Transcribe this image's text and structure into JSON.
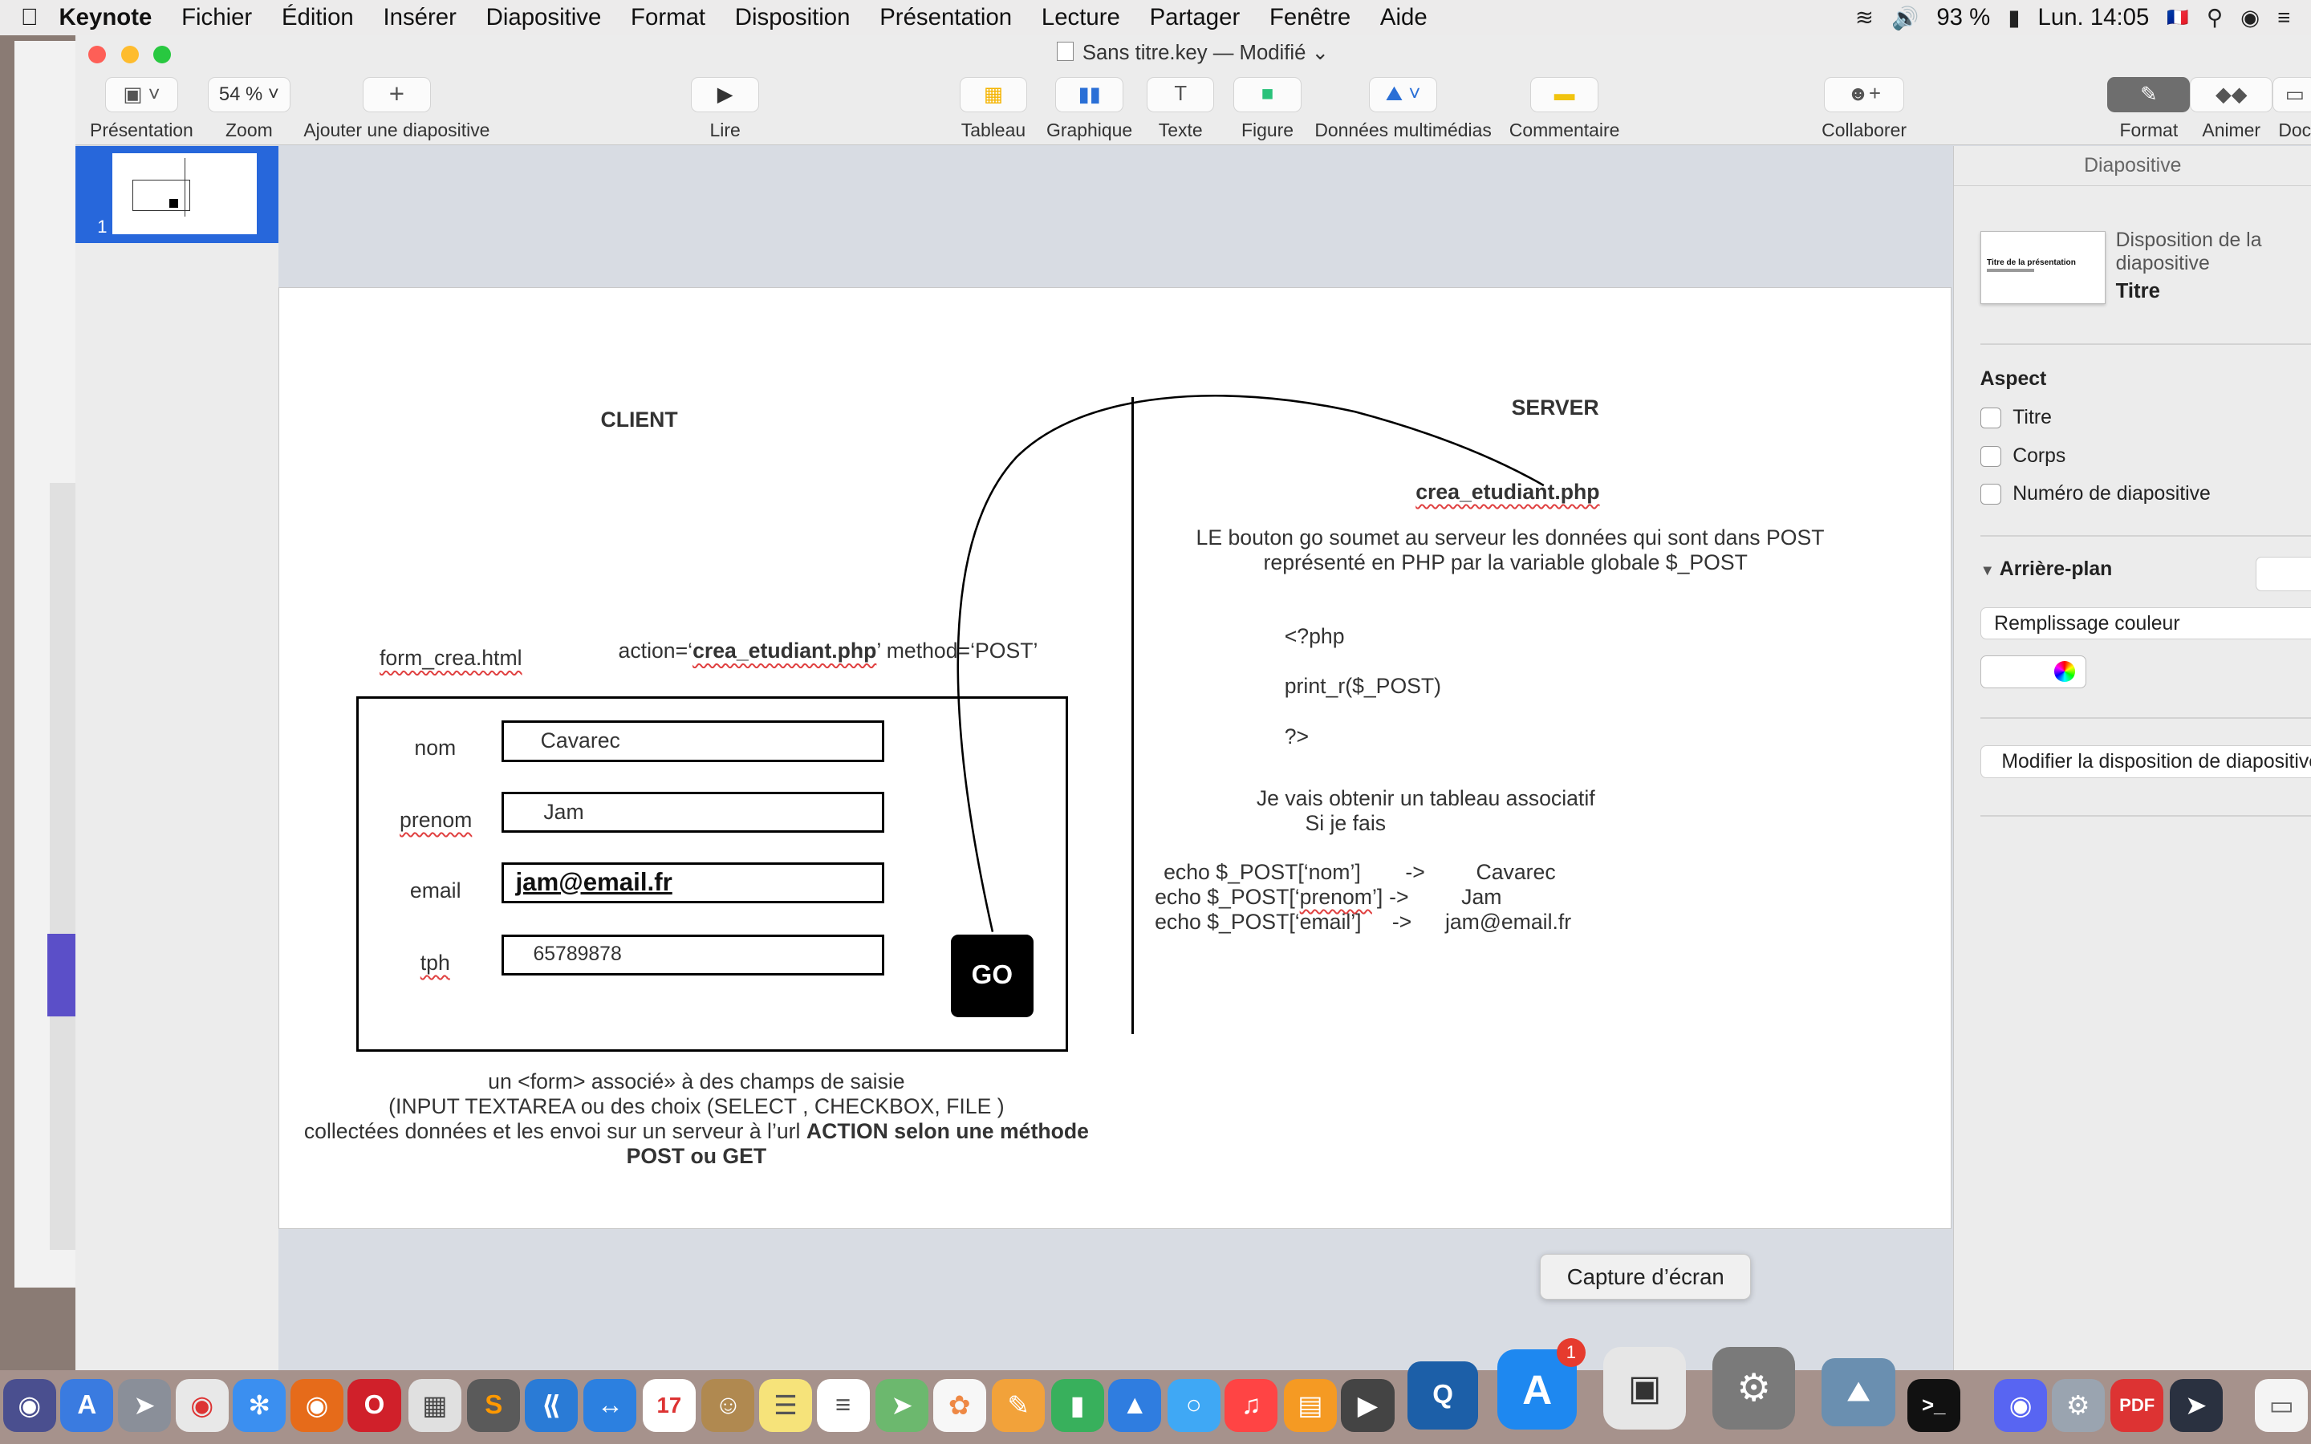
{
  "menubar": {
    "app_name": "Keynote",
    "items": [
      "Fichier",
      "Édition",
      "Insérer",
      "Diapositive",
      "Format",
      "Disposition",
      "Présentation",
      "Lecture",
      "Partager",
      "Fenêtre",
      "Aide"
    ],
    "battery": "93 %",
    "clock": "Lun. 14:05"
  },
  "window": {
    "title": "Sans titre.key — Modifié ⌄"
  },
  "toolbar": {
    "presentation": "Présentation",
    "zoom_value": "54 %",
    "zoom": "Zoom",
    "add_slide": "Ajouter une diapositive",
    "play": "Lire",
    "table": "Tableau",
    "chart": "Graphique",
    "text": "Texte",
    "shape": "Figure",
    "media": "Données multimédias",
    "comment": "Commentaire",
    "collaborate": "Collaborer",
    "format": "Format",
    "animate": "Animer",
    "document": "Doc"
  },
  "navigator": {
    "slide_number": "1"
  },
  "slide": {
    "client_title": "CLIENT",
    "server_title": "SERVER",
    "form_file": "form_crea.html",
    "action_prefix": "action=‘",
    "action_file": "crea_etudiant.php",
    "action_suffix": "’ method=‘POST’",
    "fields": [
      {
        "label": "nom",
        "value": "Cavarec"
      },
      {
        "label": "prenom",
        "value": "Jam"
      },
      {
        "label": "email",
        "value": "jam@email.fr"
      },
      {
        "label": "tph",
        "value": "65789878"
      }
    ],
    "go_label": "GO",
    "server_file": "crea_etudiant.php",
    "server_desc_1": "LE bouton go soumet au serveur les données qui sont dans POST",
    "server_desc_2": "représenté en PHP par la variable globale $_POST",
    "php_open": "<?php",
    "php_print": "print_r($_POST)",
    "php_close": "?>",
    "result_1": "Je vais obtenir un tableau associatif",
    "result_2": "Si je fais",
    "echo_lines": [
      {
        "code": "echo $_POST[‘nom’]",
        "arrow": "->",
        "value": "Cavarec"
      },
      {
        "code": "echo $_POST[‘prenom’]",
        "arrow": "->",
        "value": "Jam"
      },
      {
        "code": "echo $_POST[‘email’]",
        "arrow": "->",
        "value": "jam@email.fr"
      }
    ],
    "caption_1": "un <form> associé» à des champs de saisie",
    "caption_2": "(INPUT TEXTAREA ou des choix (SELECT , CHECKBOX, FILE )",
    "caption_3a": "collectées données et les envoi sur un serveur à l’url ",
    "caption_3b": "ACTION selon une méthode",
    "caption_4": "POST ou GET"
  },
  "inspector": {
    "tab": "Diapositive",
    "layout_label": "Disposition de la diapositive",
    "layout_name": "Titre",
    "thumb_title": "Titre de la présentation",
    "aspect": "Aspect",
    "checkbox_title": "Titre",
    "checkbox_body": "Corps",
    "checkbox_number": "Numéro de diapositive",
    "background": "Arrière-plan",
    "fill": "Remplissage couleur",
    "modify": "Modifier la disposition de diapositive"
  },
  "tooltip": "Capture d’écran",
  "dock": {
    "badge_count": "1",
    "calendar_day": "17"
  },
  "colors": {
    "accent": "#2767db",
    "close": "#fe5f57",
    "minimize": "#febc2e",
    "zoom": "#28c840"
  }
}
